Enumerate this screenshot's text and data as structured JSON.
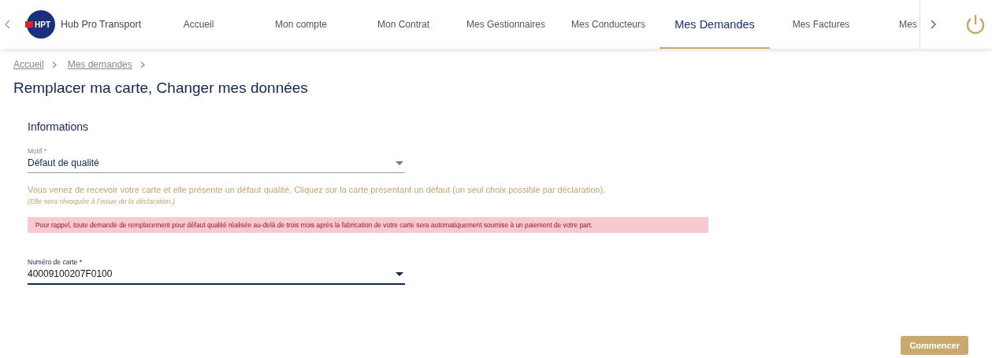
{
  "header": {
    "logo_text": "HPT",
    "brand": "Hub Pro Transport",
    "tabs": [
      {
        "label": "Accueil",
        "selected": false
      },
      {
        "label": "Mon compte",
        "selected": false
      },
      {
        "label": "Mon Contrat",
        "selected": false
      },
      {
        "label": "Mes Gestionnaires",
        "selected": false
      },
      {
        "label": "Mes Conducteurs",
        "selected": false
      },
      {
        "label": "Mes Demandes",
        "selected": true
      },
      {
        "label": "Mes Factures",
        "selected": false
      },
      {
        "label": "Mes",
        "selected": false
      }
    ]
  },
  "breadcrumb": [
    "Accueil",
    "Mes demandes"
  ],
  "title": "Remplacer ma carte, Changer mes données",
  "section": "Informations",
  "motif": {
    "label": "Motif *",
    "value": "Défaut de qualité",
    "focused": false
  },
  "info": "Vous venez de recevoir votre carte et elle présente un défaut qualité. Cliquez sur la carte présentant un défaut (un seul choix possible par déclaration).",
  "note": "(Elle sera révoquée à l’issue de la déclaration.)",
  "warning": "Pour rappel, toute demande de remplacement pour défaut qualité réalisée au-delà de trois mois après la fabrication de votre carte sera automatiquement soumise à un paiement de votre part.",
  "card": {
    "label": "Numéro de carte *",
    "value": "40009100207F0100",
    "focused": true
  },
  "button": "Commencer"
}
